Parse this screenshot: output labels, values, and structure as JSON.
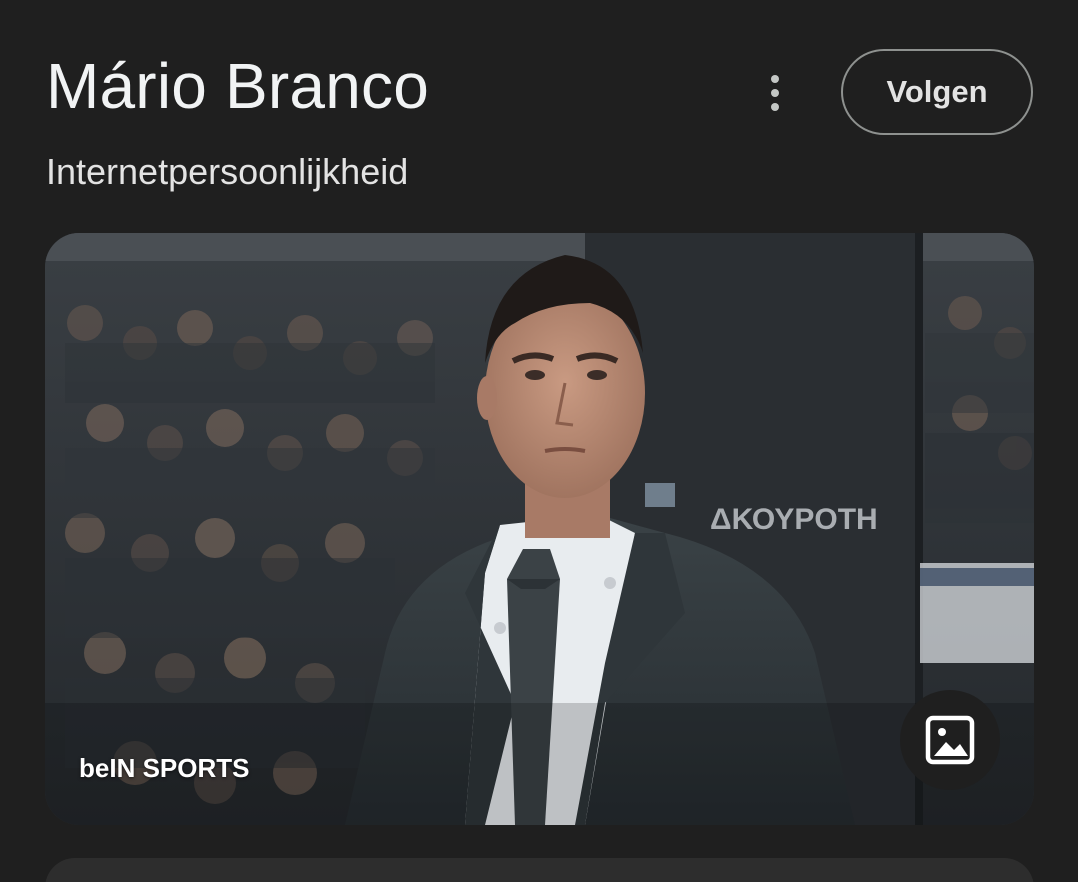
{
  "header": {
    "title": "Mário Branco",
    "subtitle": "Internetpersoonlijkheid",
    "follow_label": "Volgen",
    "more_icon": "more-vert-icon"
  },
  "photo": {
    "source": "beIN SPORTS",
    "background_sign_text": "ΔΚΟΥΡΟΤΗ",
    "image_icon": "image-icon"
  },
  "colors": {
    "background": "#1f1f1f",
    "title_text": "#f1f3f4",
    "button_border": "#8e918f",
    "card_surface": "#2d2d2d"
  }
}
